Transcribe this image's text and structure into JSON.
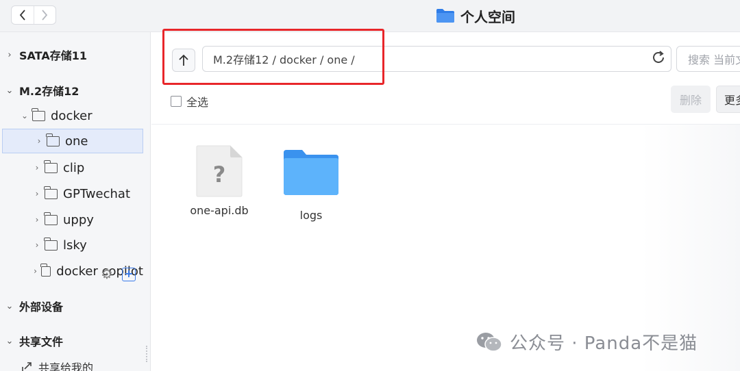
{
  "window": {
    "title": "个人空间",
    "back_icon": "chevron-left-icon",
    "forward_icon": "chevron-right-icon"
  },
  "sidebar": {
    "sections": [
      {
        "label": "SATA存储11",
        "expanded": false
      },
      {
        "label": "M.2存储12",
        "expanded": true
      },
      {
        "label": "外部设备",
        "expanded": true
      },
      {
        "label": "共享文件",
        "expanded": true
      }
    ],
    "docker_folder": "docker",
    "docker_children": [
      "one",
      "clip",
      "GPTwechat",
      "uppy",
      "lsky",
      "docker copilot"
    ],
    "selected": "one",
    "share_item": "共享给我的"
  },
  "toolbar": {
    "path": "M.2存储12 / docker / one /",
    "search_placeholder": "搜索 当前文件夹",
    "select_all_label": "全选",
    "delete_label": "删除",
    "more_label": "更多"
  },
  "files": [
    {
      "name": "one-api.db",
      "icon": "unknown-file-icon"
    },
    {
      "name": "logs",
      "icon": "folder-icon"
    }
  ],
  "watermark": {
    "text": "公众号 · Panda不是猫"
  },
  "colors": {
    "accent": "#3a7bea",
    "highlight": "#e8262a",
    "folder": "#4aa3f5"
  }
}
